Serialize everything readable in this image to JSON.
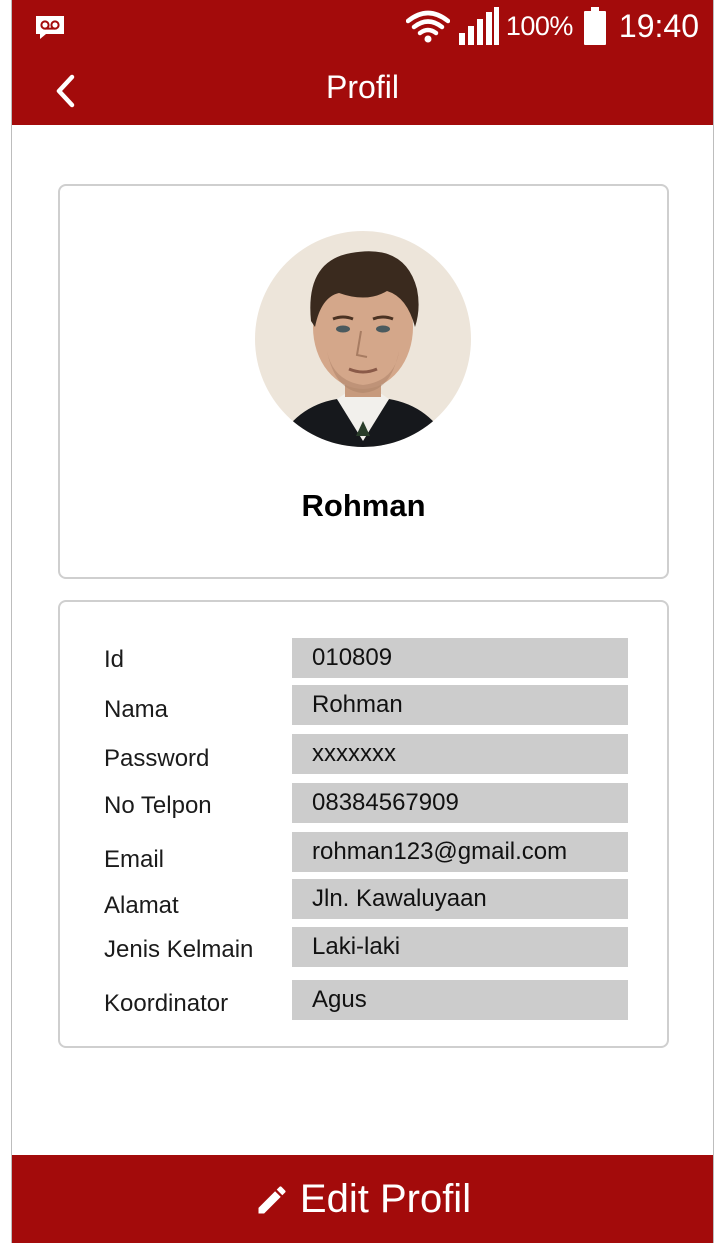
{
  "status_bar": {
    "battery": "100%",
    "time": "19:40",
    "icons": [
      "voicemail-icon",
      "wifi-icon",
      "signal-icon",
      "battery-icon"
    ]
  },
  "app_bar": {
    "title": "Profil",
    "back_icon": "chevron-left-icon"
  },
  "profile": {
    "name": "Rohman",
    "avatar": "profile-photo"
  },
  "details": [
    {
      "label": "Id",
      "value": "010809"
    },
    {
      "label": "Nama",
      "value": "Rohman"
    },
    {
      "label": "Password",
      "value": "xxxxxxx"
    },
    {
      "label": "No Telpon",
      "value": "08384567909"
    },
    {
      "label": "Email",
      "value": "rohman123@gmail.com"
    },
    {
      "label": "Alamat",
      "value": "Jln. Kawaluyaan"
    },
    {
      "label": "Jenis Kelmain",
      "value": "Laki-laki"
    },
    {
      "label": "Koordinator",
      "value": "Agus"
    }
  ],
  "edit_button": {
    "label": "Edit Profil",
    "icon": "pencil-icon"
  },
  "colors": {
    "primary": "#a30b0b",
    "field_bg": "#cccccc",
    "card_border": "#cfcfcf"
  }
}
